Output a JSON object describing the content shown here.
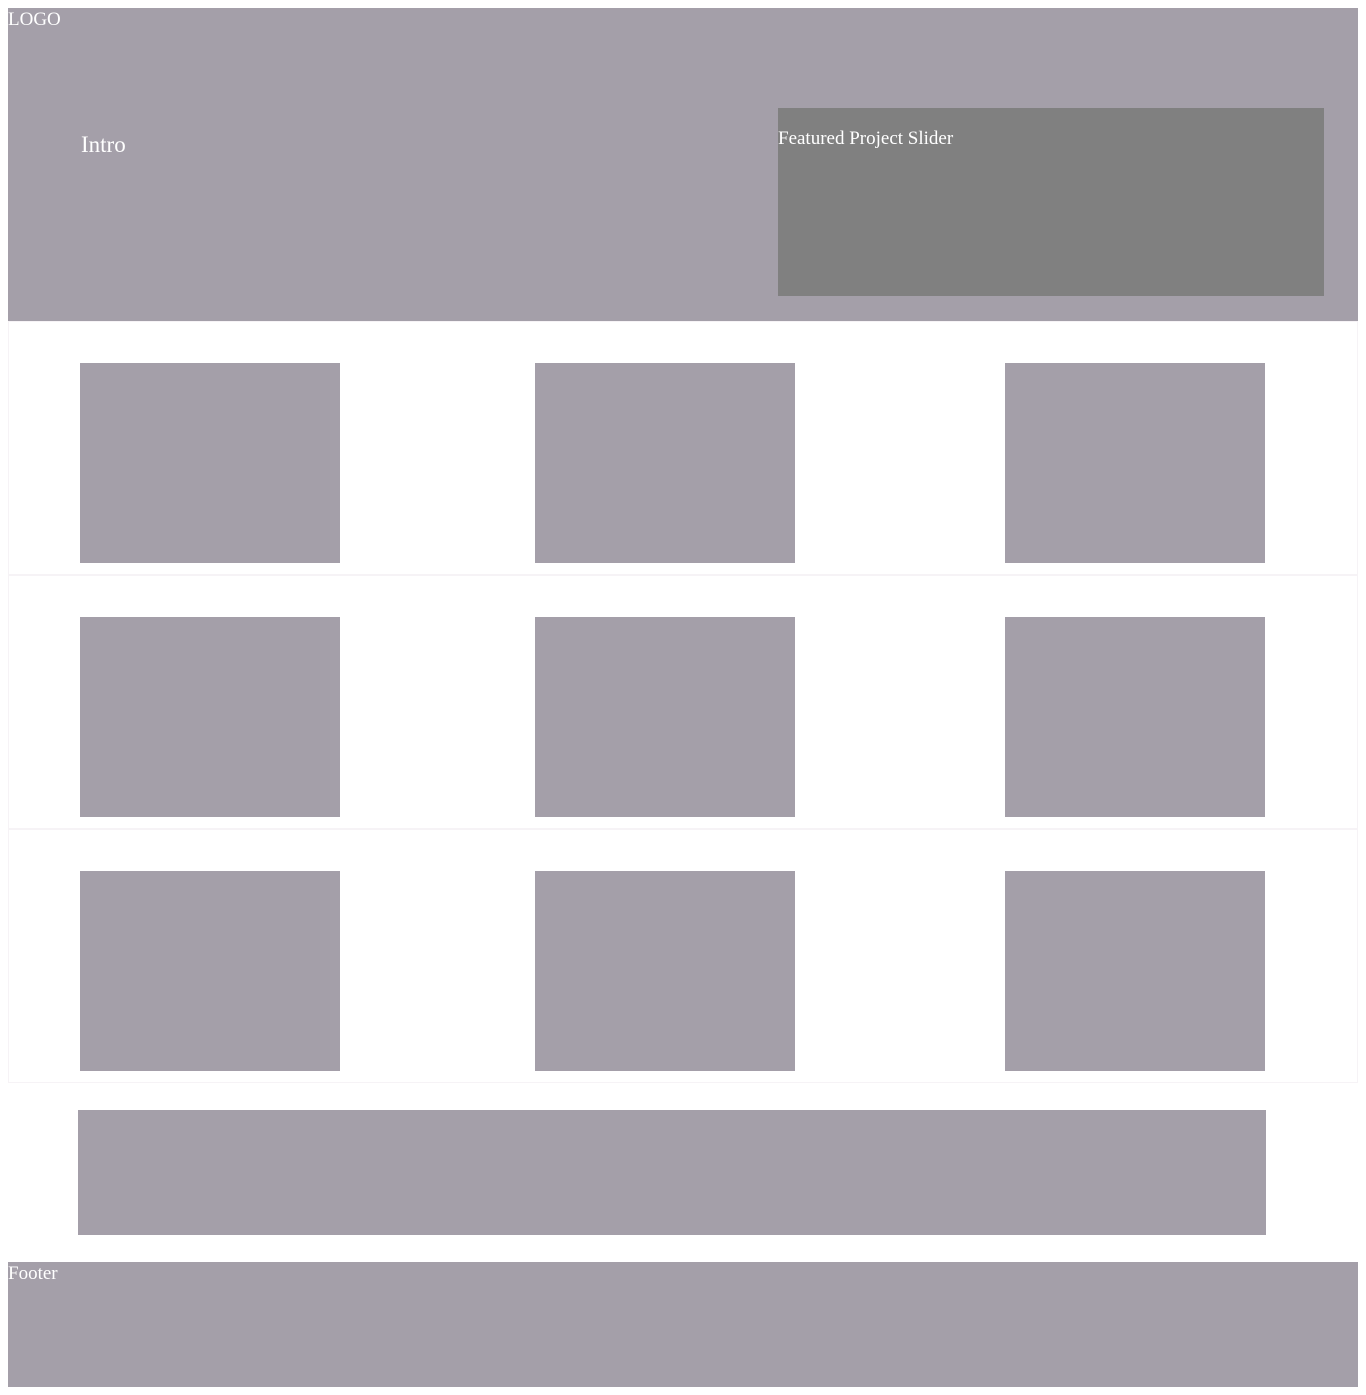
{
  "header": {
    "logo": "LOGO",
    "intro": "Intro",
    "slider": {
      "label": "Featured Project Slider"
    }
  },
  "grid": {
    "rows": [
      {
        "tiles": [
          "",
          "",
          ""
        ]
      },
      {
        "tiles": [
          "",
          "",
          ""
        ]
      },
      {
        "tiles": [
          "",
          "",
          ""
        ]
      }
    ]
  },
  "footer": {
    "label": "Footer"
  },
  "colors": {
    "placeholder": "#a49fa9",
    "slider": "#808080",
    "text": "#ffffff"
  }
}
